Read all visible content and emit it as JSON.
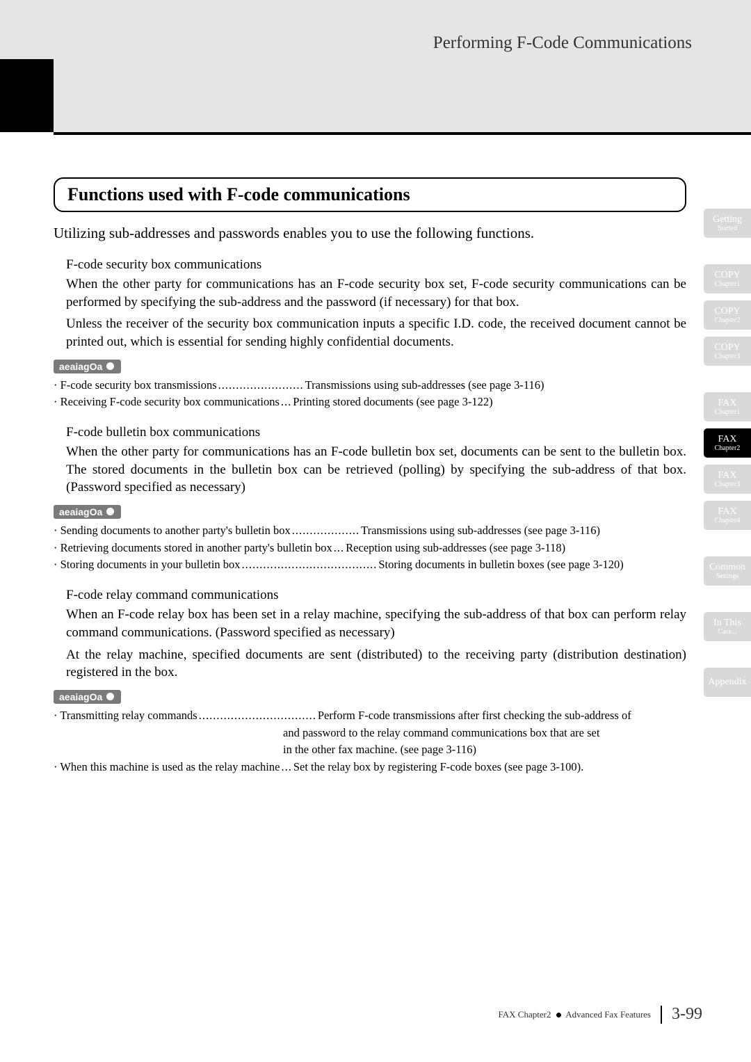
{
  "header": {
    "section_title": "Performing F-Code Communications"
  },
  "main": {
    "heading": "Functions used with F-code communications",
    "intro": "Utilizing sub-addresses and passwords enables you to use the following functions.",
    "groups": [
      {
        "title": "F-code security box communications",
        "paragraphs": [
          "When the other party for communications has an F-code security box set, F-code security communications can be performed by specifying the sub-address and the password (if necessary) for that box.",
          "Unless the receiver of the security box communication inputs a specific I.D. code, the received document cannot be printed out, which is essential for sending highly confidential documents."
        ],
        "operation_label": "aeaiagOa",
        "items": [
          {
            "term": "· F-code security box transmissions",
            "dots": "........................",
            "desc": "Transmissions using sub-addresses (see page 3-116)"
          },
          {
            "term": "· Receiving F-code security box communications",
            "dots": "...",
            "desc": "Printing stored documents (see page 3-122)"
          }
        ]
      },
      {
        "title": "F-code bulletin box communications",
        "paragraphs": [
          "When the other party for communications has an F-code bulletin box set, documents can be sent to the bulletin box. The stored documents in the bulletin box can be retrieved (polling) by specifying the sub-address of that box. (Password specified as necessary)"
        ],
        "operation_label": "aeaiagOa",
        "items": [
          {
            "term": "· Sending documents to another party's bulletin box",
            "dots": "...................",
            "desc": "Transmissions using sub-addresses (see page 3-116)"
          },
          {
            "term": "· Retrieving documents stored in another party's bulletin box",
            "dots": "...",
            "desc": "Reception using sub-addresses (see page 3-118)"
          },
          {
            "term": "· Storing documents in your bulletin box",
            "dots": "......................................",
            "desc": "Storing documents in bulletin boxes (see page 3-120)"
          }
        ]
      },
      {
        "title": "F-code relay command communications",
        "paragraphs": [
          "When an F-code relay box has been set in a relay machine, specifying the sub-address of that box can perform relay command communications. (Password specified as necessary)",
          "At the relay machine, specified documents are sent (distributed) to the receiving party (distribution destination) registered in the box."
        ],
        "operation_label": "aeaiagOa",
        "items_complex": {
          "row1_term": "· Transmitting relay commands",
          "row1_dots": ".................................",
          "row1_desc": "Perform F-code transmissions after first checking the sub-address of",
          "row1_cont1": "and password to the relay command communications box that are set",
          "row1_cont2": "in the other fax machine. (see page 3-116)",
          "row2_term": "· When this machine is used as the relay machine",
          "row2_dots": "...",
          "row2_desc": "Set the relay box by registering F-code boxes (see page 3-100)."
        }
      }
    ]
  },
  "tabs": [
    {
      "line1": "Getting",
      "line2": "Started",
      "active": false
    },
    {
      "line1": "COPY",
      "line2": "Chapter1",
      "active": false
    },
    {
      "line1": "COPY",
      "line2": "Chapter2",
      "active": false
    },
    {
      "line1": "COPY",
      "line2": "Chapter3",
      "active": false
    },
    {
      "line1": "FAX",
      "line2": "Chapter1",
      "active": false
    },
    {
      "line1": "FAX",
      "line2": "Chapter2",
      "active": true
    },
    {
      "line1": "FAX",
      "line2": "Chapter3",
      "active": false
    },
    {
      "line1": "FAX",
      "line2": "Chapter4",
      "active": false
    },
    {
      "line1": "Common",
      "line2": "Settings",
      "active": false
    },
    {
      "line1": "In This",
      "line2": "Case...",
      "active": false
    },
    {
      "line1": "Appendix",
      "line2": "",
      "active": false
    }
  ],
  "footer": {
    "trail_prefix": "FAX Chapter2",
    "trail_suffix": "Advanced Fax Features",
    "page": "3-99"
  }
}
